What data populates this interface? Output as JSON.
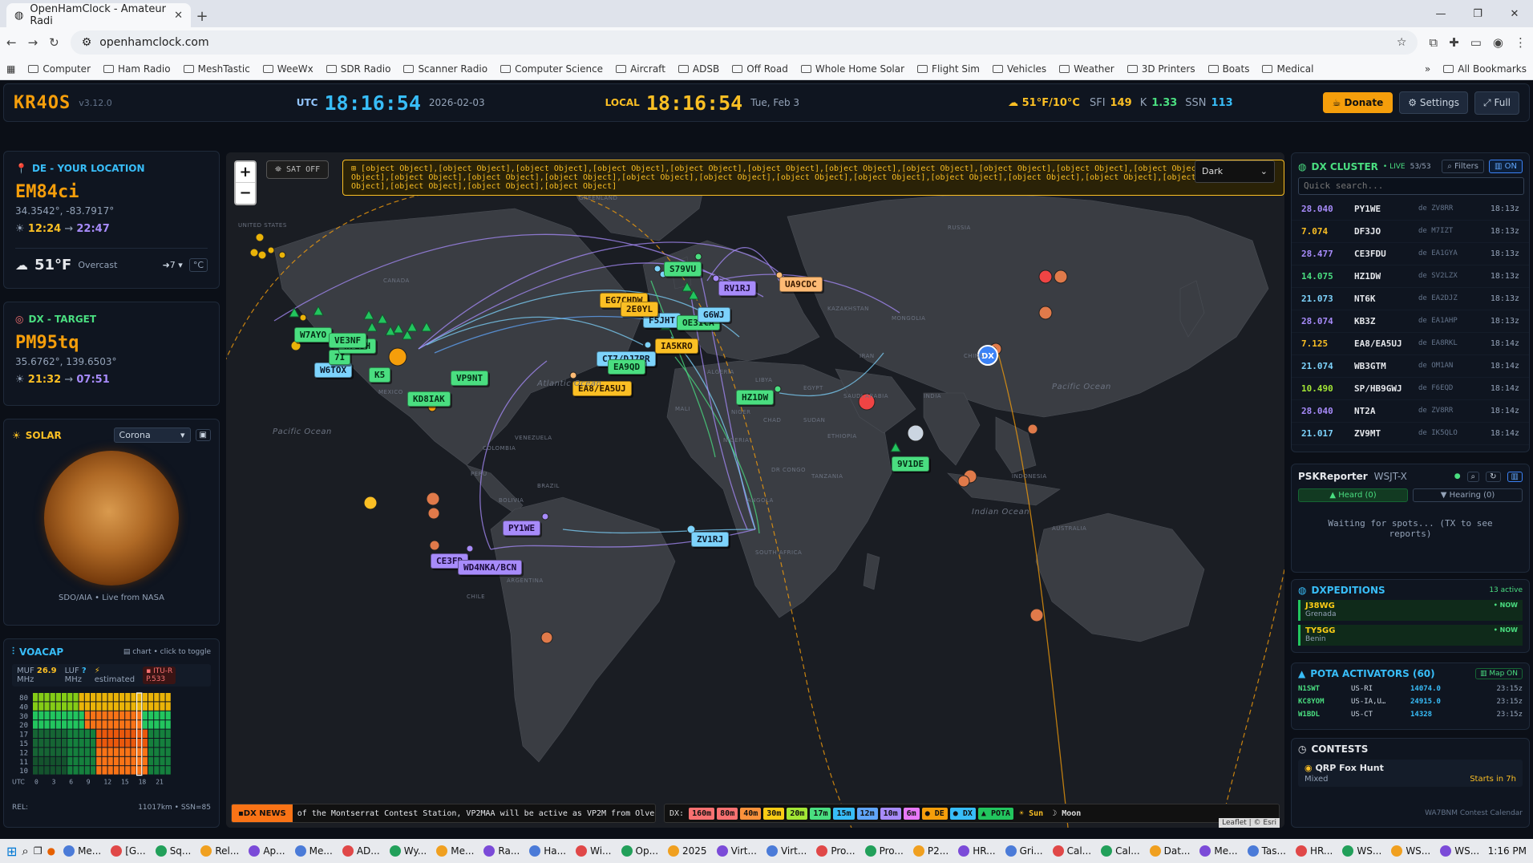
{
  "browser": {
    "tab_title": "OpenHamClock - Amateur Radi",
    "url": "openhamclock.com",
    "bookmarks": [
      "Computer",
      "Ham Radio",
      "MeshTastic",
      "WeeWx",
      "SDR Radio",
      "Scanner Radio",
      "Computer Science",
      "Aircraft",
      "ADSB",
      "Off Road",
      "Whole Home Solar",
      "Flight Sim",
      "Vehicles",
      "Weather",
      "3D Printers",
      "Boats",
      "Medical"
    ],
    "all_bookmarks": "All Bookmarks"
  },
  "header": {
    "logo": "KR4OS",
    "version": "v3.12.0",
    "utc_label": "UTC",
    "utc_time": "18:16:54",
    "utc_date": "2026-02-03",
    "local_label": "LOCAL",
    "local_time": "18:16:54",
    "local_date": "Tue, Feb 3",
    "weather": "51°F/10°C",
    "sfi_label": "SFI",
    "sfi": "149",
    "k_label": "K",
    "k": "1.33",
    "ssn_label": "SSN",
    "ssn": "113",
    "donate": "Donate",
    "settings": "Settings",
    "full": "Full"
  },
  "de": {
    "title": "DE - YOUR LOCATION",
    "grid": "EM84ci",
    "coords": "34.3542°, -83.7917°",
    "sunrise": "12:24",
    "sunset": "22:47",
    "temp": "51°F",
    "cond": "Overcast",
    "wind": "7",
    "unit": "°C"
  },
  "dx": {
    "title": "DX - TARGET",
    "grid": "PM95tq",
    "coords": "35.6762°, 139.6503°",
    "sunrise": "21:32",
    "sunset": "07:51"
  },
  "solar": {
    "title": "SOLAR",
    "select": "Corona",
    "caption": "SDO/AIA • Live from NASA"
  },
  "voacap": {
    "title": "VOACAP",
    "toggle": "chart • click to toggle",
    "muf_label": "MUF",
    "muf": "26.9",
    "muf_unit": "MHz",
    "luf_label": "LUF",
    "luf": "?",
    "luf_unit": "MHz",
    "estimated": "estimated",
    "itu": "ITU-R",
    "p533": "P.533",
    "bands": [
      "80",
      "40",
      "30",
      "20",
      "17",
      "15",
      "12",
      "11",
      "10"
    ],
    "hours": [
      "0",
      "3",
      "6",
      "9",
      "12",
      "15",
      "18",
      "21"
    ],
    "utc": "UTC",
    "rel": "REL:",
    "footer": "11017km • SSN=85"
  },
  "map": {
    "sat": "SAT OFF",
    "calls": [
      {
        "t": "S79VU",
        "c": "cg"
      },
      {
        "t": "RV1RJ",
        "c": "cp"
      },
      {
        "t": "UA9CDC",
        "c": "cs"
      },
      {
        "t": "W7AYO",
        "c": "cg"
      },
      {
        "t": "W6TOX",
        "c": "cb"
      },
      {
        "t": "VP9NT",
        "c": "cg"
      },
      {
        "t": "KD8IAK",
        "c": "cg"
      },
      {
        "t": "F5JHT",
        "c": "cb"
      },
      {
        "t": "OE3ICA",
        "c": "cg"
      },
      {
        "t": "IA5KRO",
        "c": "co"
      },
      {
        "t": "CT7/DJ7PR",
        "c": "cb"
      },
      {
        "t": "EA9QD",
        "c": "cg"
      },
      {
        "t": "EA8/EA5UJ",
        "c": "co"
      },
      {
        "t": "HZ1DW",
        "c": "cg"
      },
      {
        "t": "9V1DE",
        "c": "cg"
      },
      {
        "t": "PY1WE",
        "c": "cp"
      },
      {
        "t": "ZV1RJ",
        "c": "cb"
      },
      {
        "t": "CE3FD",
        "c": "cp"
      },
      {
        "t": "WD4NKA/BCN",
        "c": "cp"
      },
      {
        "t": "EG7CHDW",
        "c": "co"
      },
      {
        "t": "2E0YL",
        "c": "co"
      },
      {
        "t": "G6WJ",
        "c": "cb"
      },
      {
        "t": "7I",
        "c": "cg"
      },
      {
        "t": "W7EDH",
        "c": "cg"
      },
      {
        "t": "VE3NF",
        "c": "cg"
      },
      {
        "t": "K5",
        "c": "cg"
      },
      {
        "t": "DX",
        "c": "cb"
      }
    ],
    "theme": "Dark",
    "dx_news_label": "DX NEWS",
    "dx_news": "of the Montserrat Contest Station, VP2MAA will be active as VP2M from Olveston, Monts",
    "dx_label": "DX:",
    "bands": [
      "160m",
      "80m",
      "40m",
      "30m",
      "20m",
      "17m",
      "15m",
      "12m",
      "10m",
      "6m"
    ],
    "legend": [
      "DE",
      "DX",
      "POTA",
      "Sun",
      "Moon"
    ],
    "attribution": "Leaflet | © Esri",
    "labels": {
      "greenland": "GREENLAND",
      "canada": "CANADA",
      "us": "UNITED STATES",
      "mexico": "MEXICO",
      "pacific1": "Pacific Ocean",
      "pacific2": "Pacific Ocean",
      "atlantic": "Atlantic Ocean",
      "indian": "Indian Ocean",
      "russia": "RUSSIA",
      "kazakhstan": "KAZAKHSTAN",
      "mongolia": "MONGOLIA",
      "china": "CHINA",
      "india": "INDIA",
      "brazil": "BRAZIL",
      "venezuela": "VENEZUELA",
      "colombia": "COLOMBIA",
      "peru": "PERU",
      "bolivia": "BOLIVIA",
      "argentina": "ARGENTINA",
      "chile": "CHILE",
      "algeria": "ALGERIA",
      "libya": "LIBYA",
      "egypt": "EGYPT",
      "mali": "MALI",
      "niger": "NIGER",
      "chad": "CHAD",
      "sudan": "SUDAN",
      "ethiopia": "ETHIOPIA",
      "nigeria": "NIGERIA",
      "drc": "DR CONGO",
      "angola": "ANGOLA",
      "tanzania": "TANZANIA",
      "south_africa": "SOUTH AFRICA",
      "australia": "AUSTRALIA",
      "indonesia": "INDONESIA",
      "iran": "IRAN",
      "saudi": "SAUDI ARABIA"
    }
  },
  "cluster": {
    "title": "DX CLUSTER",
    "live": "• LIVE",
    "count": "53/53",
    "filters": "Filters",
    "on": "ON",
    "search_placeholder": "Quick search...",
    "spots": [
      {
        "f": "28.040",
        "c": "PY1WE",
        "d": "de ZV8RR",
        "t": "18:13z",
        "col": "#a78bfa"
      },
      {
        "f": "7.074",
        "c": "DF3JO",
        "d": "de M7IZT",
        "t": "18:13z",
        "col": "#fbbf24"
      },
      {
        "f": "28.477",
        "c": "CE3FDU",
        "d": "de EA1GYA",
        "t": "18:13z",
        "col": "#a78bfa"
      },
      {
        "f": "14.075",
        "c": "HZ1DW",
        "d": "de SV2LZX",
        "t": "18:13z",
        "col": "#4ade80"
      },
      {
        "f": "21.073",
        "c": "NT6K",
        "d": "de EA2DJZ",
        "t": "18:13z",
        "col": "#7dd3fc"
      },
      {
        "f": "28.074",
        "c": "KB3Z",
        "d": "de EA1AHP",
        "t": "18:13z",
        "col": "#a78bfa"
      },
      {
        "f": "7.125",
        "c": "EA8/EA5UJ",
        "d": "de EA8RKL",
        "t": "18:14z",
        "col": "#fbbf24"
      },
      {
        "f": "21.074",
        "c": "WB3GTM",
        "d": "de OM1AN",
        "t": "18:14z",
        "col": "#7dd3fc"
      },
      {
        "f": "10.490",
        "c": "SP/HB9GWJ",
        "d": "de F6EQD",
        "t": "18:14z",
        "col": "#a3e635"
      },
      {
        "f": "28.040",
        "c": "NT2A",
        "d": "de ZV8RR",
        "t": "18:14z",
        "col": "#a78bfa"
      },
      {
        "f": "21.017",
        "c": "ZV9MT",
        "d": "de IK5QLO",
        "t": "18:14z",
        "col": "#7dd3fc"
      }
    ]
  },
  "psk": {
    "title": "PSKReporter",
    "mode": "WSJT-X",
    "heard": "Heard (0)",
    "hearing": "Hearing (0)",
    "waiting": "Waiting for spots... (TX to see reports)"
  },
  "dxpeditions": {
    "title": "DXPEDITIONS",
    "active": "13 active",
    "items": [
      {
        "call": "J38WG",
        "loc": "Grenada",
        "now": "• NOW"
      },
      {
        "call": "TY5GG",
        "loc": "Benin",
        "now": "• NOW"
      }
    ]
  },
  "pota": {
    "title": "POTA ACTIVATORS (60)",
    "map": "Map ON",
    "items": [
      {
        "call": "N1SWT",
        "loc": "US-RI",
        "freq": "14074.0",
        "t": "23:15z"
      },
      {
        "call": "KC8YOM",
        "loc": "US-IA,U…",
        "freq": "24915.0",
        "t": "23:15z"
      },
      {
        "call": "W1BDL",
        "loc": "US-CT",
        "freq": "14328",
        "t": "23:15z"
      }
    ]
  },
  "contests": {
    "title": "CONTESTS",
    "name": "QRP Fox Hunt",
    "mode": "Mixed",
    "starts": "Starts in 7h",
    "footer": "WA7BNM Contest Calendar"
  },
  "taskbar": {
    "items": [
      "Me...",
      "[G...",
      "Sq...",
      "Rel...",
      "Ap...",
      "Me...",
      "AD...",
      "Wy...",
      "Me...",
      "Ra...",
      "Ha...",
      "Wi...",
      "Op...",
      "2025",
      "Virt...",
      "Virt...",
      "Pro...",
      "Pro...",
      "P2...",
      "HR...",
      "Gri...",
      "Cal...",
      "Cal...",
      "Dat...",
      "Me...",
      "Tas...",
      "HR...",
      "WS...",
      "WS...",
      "WS..."
    ],
    "time": "1:16 PM"
  }
}
